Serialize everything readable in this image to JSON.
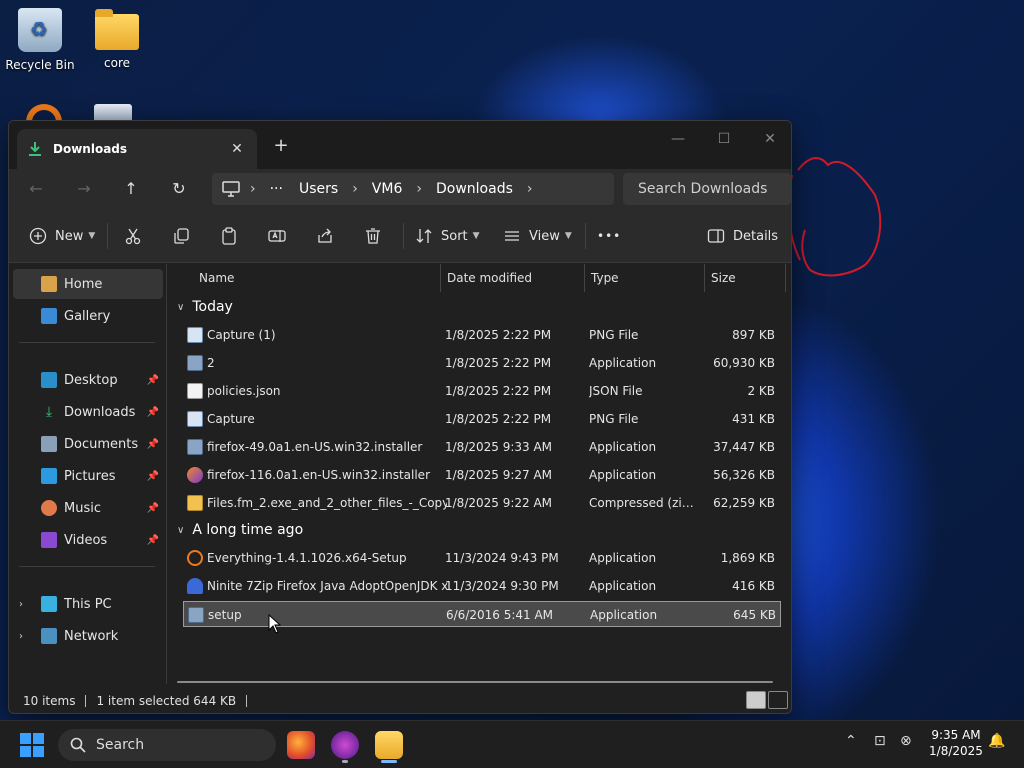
{
  "desktop": {
    "icons": [
      {
        "label": "Recycle Bin"
      },
      {
        "label": "core"
      }
    ]
  },
  "window": {
    "tab_title": "Downloads",
    "new_tab": "+",
    "controls": {
      "minimize": "—",
      "maximize": "☐",
      "close": "✕"
    }
  },
  "navbar": {
    "back": "←",
    "forward": "→",
    "up": "↑",
    "refresh": "↻",
    "breadcrumb": [
      "Users",
      "VM6",
      "Downloads"
    ],
    "ellipsis": "···",
    "search_placeholder": "Search Downloads"
  },
  "toolbar": {
    "new_label": "New",
    "sort_label": "Sort",
    "view_label": "View",
    "more_label": "•••",
    "details_label": "Details"
  },
  "sidebar": {
    "home": "Home",
    "gallery": "Gallery",
    "desktop": "Desktop",
    "downloads": "Downloads",
    "documents": "Documents",
    "pictures": "Pictures",
    "music": "Music",
    "videos": "Videos",
    "this_pc": "This PC",
    "network": "Network"
  },
  "columns": {
    "name": "Name",
    "date": "Date modified",
    "type": "Type",
    "size": "Size"
  },
  "groups": {
    "today": {
      "label": "Today",
      "rows": [
        {
          "name": "Capture (1)",
          "date": "1/8/2025 2:22 PM",
          "type": "PNG File",
          "size": "897 KB"
        },
        {
          "name": "2",
          "date": "1/8/2025 2:22 PM",
          "type": "Application",
          "size": "60,930 KB"
        },
        {
          "name": "policies.json",
          "date": "1/8/2025 2:22 PM",
          "type": "JSON File",
          "size": "2 KB"
        },
        {
          "name": "Capture",
          "date": "1/8/2025 2:22 PM",
          "type": "PNG File",
          "size": "431 KB"
        },
        {
          "name": "firefox-49.0a1.en-US.win32.installer",
          "date": "1/8/2025 9:33 AM",
          "type": "Application",
          "size": "37,447 KB"
        },
        {
          "name": "firefox-116.0a1.en-US.win32.installer",
          "date": "1/8/2025 9:27 AM",
          "type": "Application",
          "size": "56,326 KB"
        },
        {
          "name": "Files.fm_2.exe_and_2_other_files_-_Copy",
          "date": "1/8/2025 9:22 AM",
          "type": "Compressed (zipp...",
          "size": "62,259 KB"
        }
      ]
    },
    "long_ago": {
      "label": "A long time ago",
      "rows": [
        {
          "name": "Everything-1.4.1.1026.x64-Setup",
          "date": "11/3/2024 9:43 PM",
          "type": "Application",
          "size": "1,869 KB"
        },
        {
          "name": "Ninite 7Zip Firefox Java AdoptOpenJDK x...",
          "date": "11/3/2024 9:30 PM",
          "type": "Application",
          "size": "416 KB"
        },
        {
          "name": "setup",
          "date": "6/6/2016 5:41 AM",
          "type": "Application",
          "size": "645 KB"
        }
      ]
    }
  },
  "status": {
    "items": "10 items",
    "selected": "1 item selected  644 KB"
  },
  "taskbar": {
    "search_label": "Search",
    "time": "9:35 AM",
    "date": "1/8/2025"
  },
  "colors": {
    "accent": "#3aa0ff",
    "folder": "#f2c14e",
    "selection": "#4a4a4a"
  }
}
